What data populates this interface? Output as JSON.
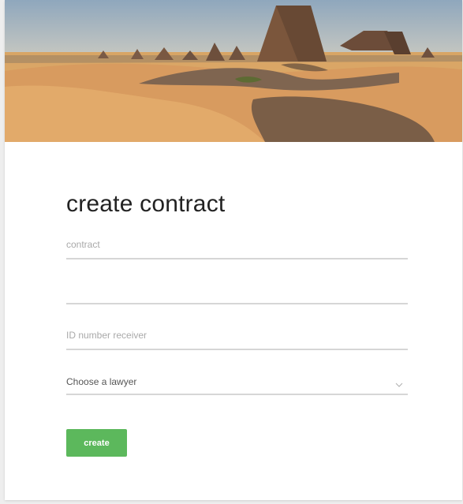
{
  "form": {
    "title": "create contract",
    "contract_placeholder": "contract",
    "contract_value": "",
    "extra_value": "",
    "id_receiver_placeholder": "ID number receiver",
    "id_receiver_value": "",
    "lawyer_select_label": "Choose a lawyer",
    "create_label": "create"
  },
  "colors": {
    "accent_button": "#5cb85c",
    "field_underline": "#d6d6d6"
  },
  "icons": {
    "select_chevron": "chevron-down-icon"
  }
}
